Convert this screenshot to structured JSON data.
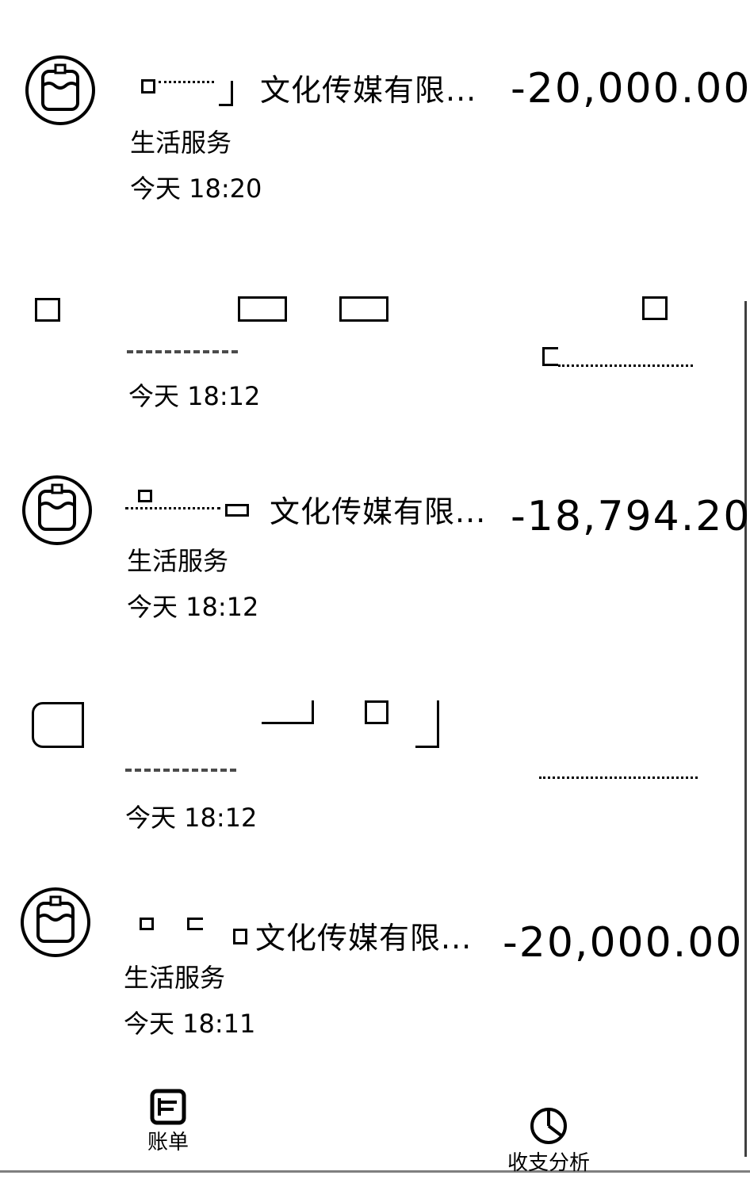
{
  "transactions": [
    {
      "merchant": "文化传媒有限...",
      "amount": "-20,000.00",
      "category": "生活服务",
      "time": "今天  18:20"
    },
    {
      "merchant": "",
      "amount": "",
      "category": "",
      "time": "今天  18:12"
    },
    {
      "merchant": "文化传媒有限...",
      "amount": "-18,794.20",
      "category": "生活服务",
      "time": "今天  18:12"
    },
    {
      "merchant": "",
      "amount": "",
      "category": "",
      "time": "今天  18:12"
    },
    {
      "merchant": "文化传媒有限...",
      "amount": "-20,000.00",
      "category": "生活服务",
      "time": "今天  18:11"
    }
  ],
  "tabbar": {
    "bill_label": "账单",
    "analysis_label": "收支分析",
    "bill_icon": "bill-icon",
    "analysis_icon": "pie-chart-icon"
  }
}
